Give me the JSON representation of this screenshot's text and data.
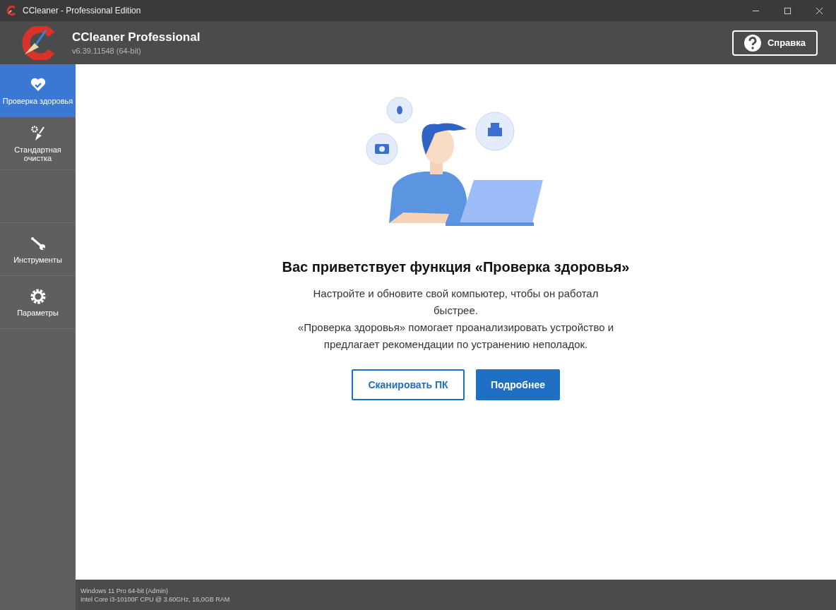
{
  "window": {
    "title": "CCleaner - Professional Edition"
  },
  "header": {
    "product": "CCleaner Professional",
    "version": "v6.39.11548 (64-bit)",
    "help_button": "Справка"
  },
  "sidebar": {
    "items": [
      {
        "kind": "health",
        "label": "Проверка здоровья",
        "selected": true
      },
      {
        "kind": "cleaning",
        "label": "Стандартная очистка",
        "selected": false
      },
      {
        "kind": "tools",
        "label": "Инструменты",
        "selected": false
      },
      {
        "kind": "settings",
        "label": "Параметры",
        "selected": false
      }
    ]
  },
  "main": {
    "heading": "Вас приветствует функция «Проверка здоровья»",
    "paragraphs": [
      "Настройте и обновите свой компьютер, чтобы он работал быстрее.",
      "«Проверка здоровья» помогает проанализировать устройство и предлагает рекомендации по устранению неполадок."
    ],
    "buttons": [
      {
        "kind": "outline",
        "label": "Сканировать ПК"
      },
      {
        "kind": "primary",
        "label": "Подробнее"
      }
    ]
  },
  "status_bar": [
    "Windows 11 Pro 64-bit (Admin)",
    "Intel Core i3-10100F CPU @ 3.60GHz, 16,0GB RAM"
  ]
}
